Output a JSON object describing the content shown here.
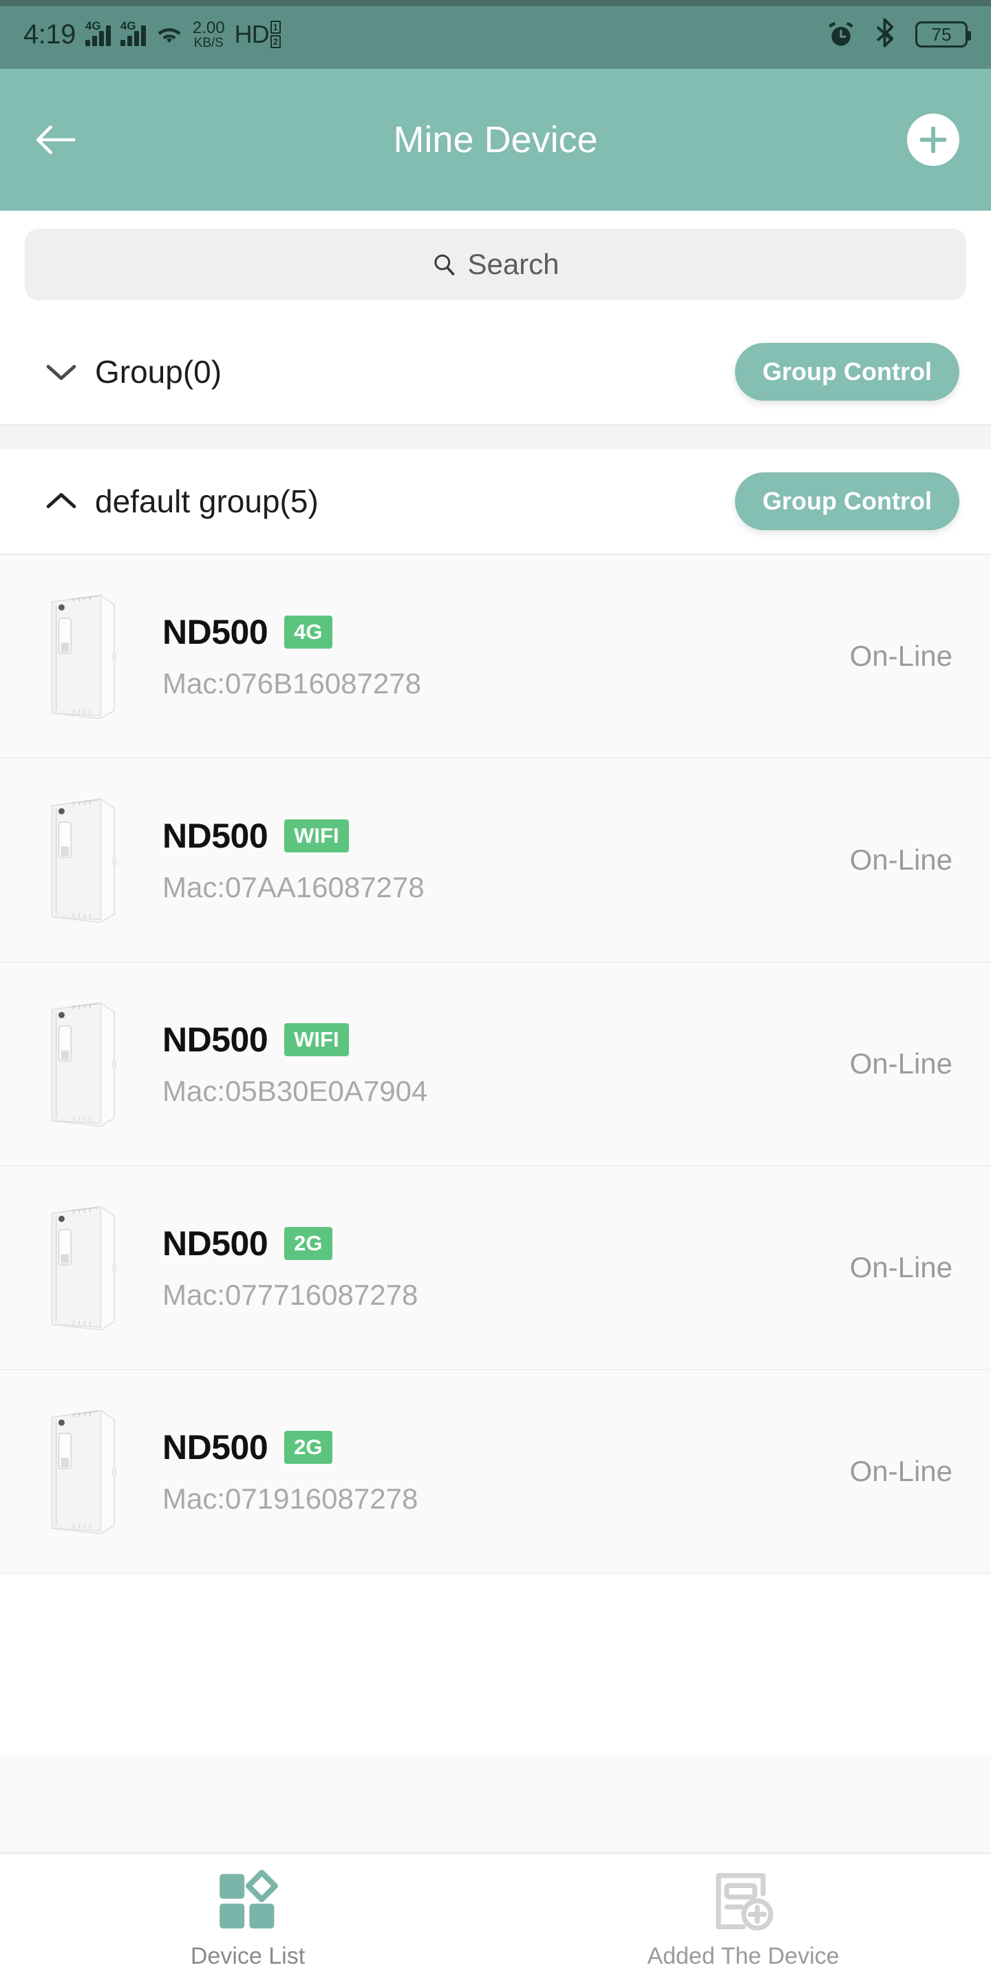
{
  "statusbar": {
    "time": "4:19",
    "network_label_1": "4G",
    "network_label_2": "4G",
    "wifi_icon": "wifi-icon",
    "data_speed_value": "2.00",
    "data_speed_unit": "KB/S",
    "hd_label": "HD",
    "sim_1": "1",
    "sim_2": "2",
    "alarm_icon": "alarm-clock-icon",
    "bluetooth_icon": "bluetooth-icon",
    "battery_level": "75"
  },
  "appbar": {
    "back_icon": "back-arrow-icon",
    "title": "Mine Device",
    "add_icon": "plus-icon"
  },
  "search": {
    "icon": "search-icon",
    "placeholder": "Search"
  },
  "groups": [
    {
      "chevron": "chevron-down-icon",
      "expanded": false,
      "name": "Group(0)",
      "control_label": "Group Control"
    },
    {
      "chevron": "chevron-up-icon",
      "expanded": true,
      "name": "default group(5)",
      "control_label": "Group Control"
    }
  ],
  "devices": [
    {
      "thumb": "device-thumbnail",
      "name": "ND500",
      "badge": "4G",
      "mac": "Mac:076B16087278",
      "status": "On-Line"
    },
    {
      "thumb": "device-thumbnail",
      "name": "ND500",
      "badge": "WIFI",
      "mac": "Mac:07AA16087278",
      "status": "On-Line"
    },
    {
      "thumb": "device-thumbnail",
      "name": "ND500",
      "badge": "WIFI",
      "mac": "Mac:05B30E0A7904",
      "status": "On-Line"
    },
    {
      "thumb": "device-thumbnail",
      "name": "ND500",
      "badge": "2G",
      "mac": "Mac:077716087278",
      "status": "On-Line"
    },
    {
      "thumb": "device-thumbnail",
      "name": "ND500",
      "badge": "2G",
      "mac": "Mac:071916087278",
      "status": "On-Line"
    }
  ],
  "bottomnav": [
    {
      "icon": "device-list-icon",
      "label": "Device List",
      "active": true
    },
    {
      "icon": "add-device-icon",
      "label": "Added The Device",
      "active": false
    }
  ],
  "colors": {
    "statusbar_bg": "#5d8f87",
    "appbar_bg": "#83bcb0",
    "accent_teal": "#85beb2",
    "badge_green": "#5cc47f",
    "nav_active": "#7bb5a9",
    "nav_inactive": "#d2d2d2"
  }
}
